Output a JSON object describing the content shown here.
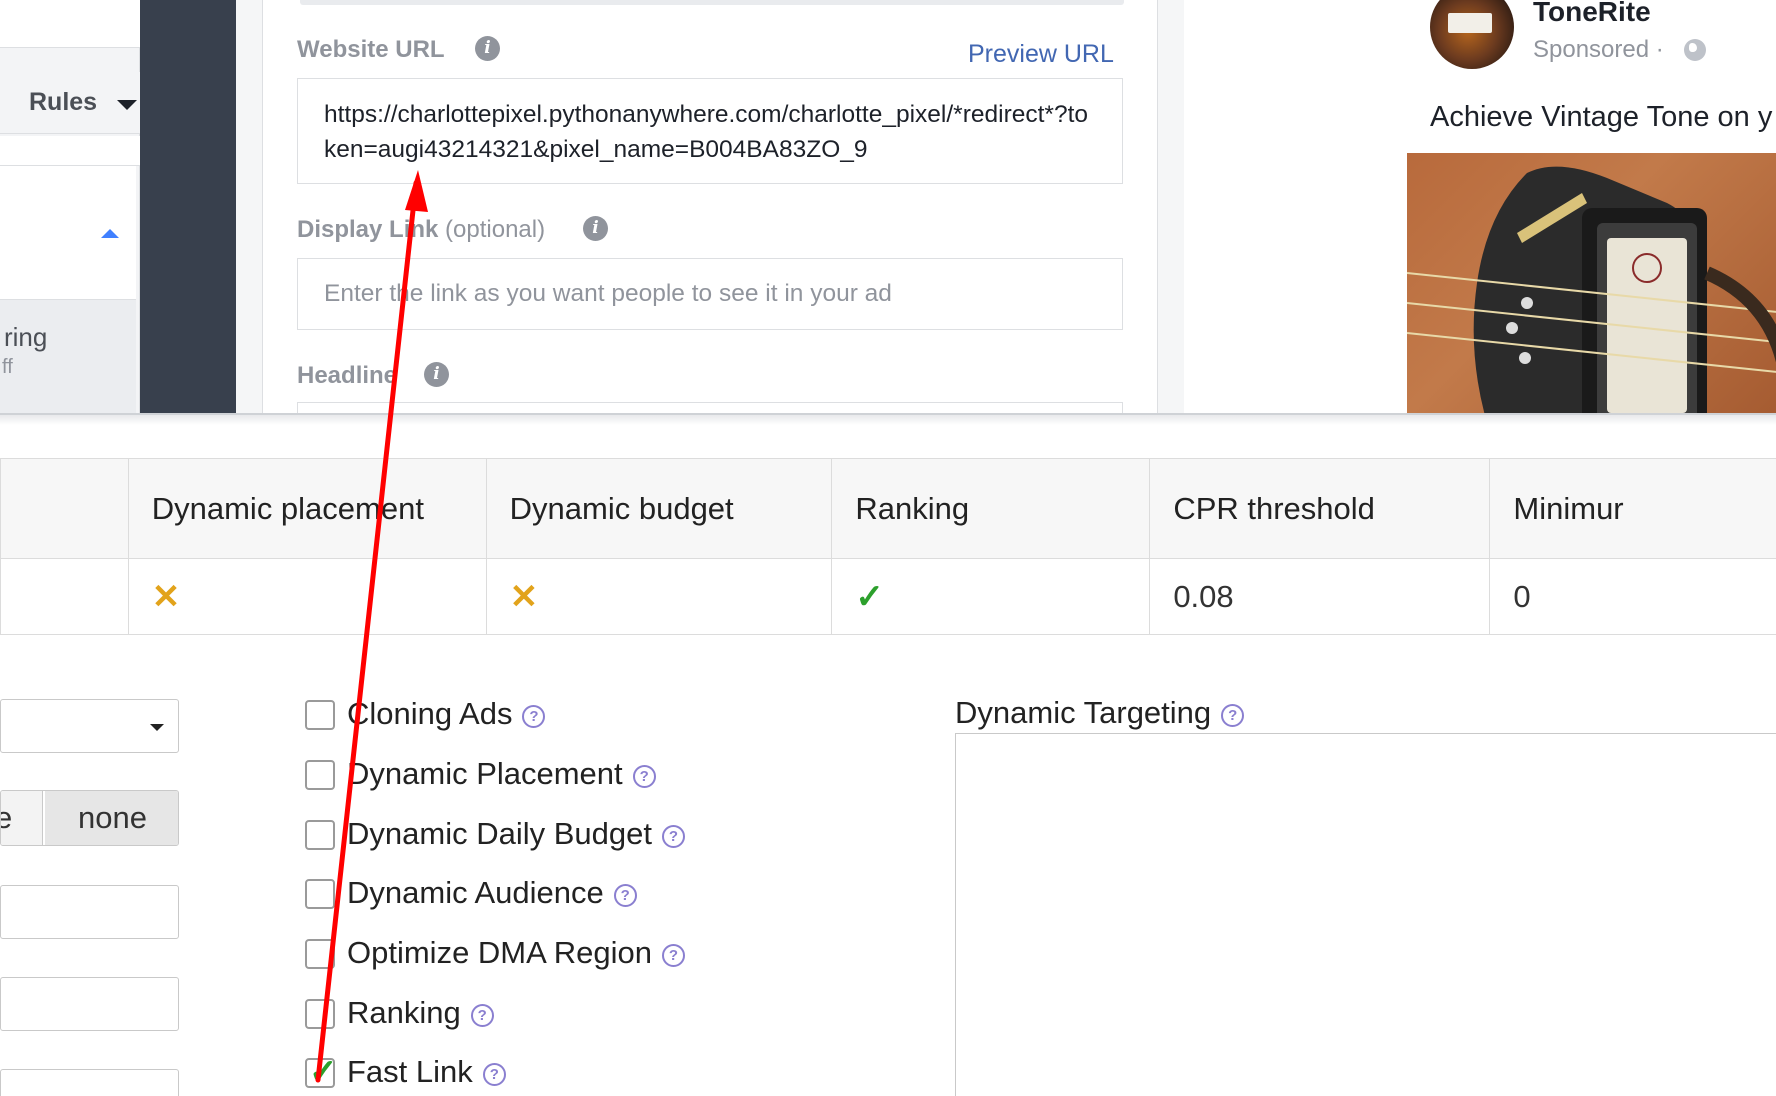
{
  "fb_editor": {
    "rules_label": "Rules",
    "sidebar_partial_text_1": "ring",
    "sidebar_partial_text_2": "ff",
    "website_url_label": "Website URL",
    "preview_url_link": "Preview URL",
    "website_url_value": "https://charlottepixel.pythonanywhere.com/charlotte_pixel/*redirect*?token=augi43214321&pixel_name=B004BA83ZO_9",
    "display_link_label": "Display Link",
    "display_link_optional": "(optional)",
    "display_link_placeholder": "Enter the link as you want people to see it in your ad",
    "headline_label": "Headline",
    "info_glyph": "i"
  },
  "ad_preview": {
    "page_name": "ToneRite",
    "sponsored_label": "Sponsored ·",
    "ad_text": "Achieve Vintage Tone on y"
  },
  "options_table": {
    "headers": [
      "",
      "Dynamic placement",
      "Dynamic budget",
      "Ranking",
      "CPR threshold",
      "Minimur"
    ],
    "row": {
      "dynamic_placement": "✕",
      "dynamic_budget": "✕",
      "ranking": "✓",
      "cpr_threshold": "0.08",
      "minimum": "0"
    }
  },
  "settings": {
    "segment_partial": "e",
    "segment_none": "none",
    "help_glyph": "?",
    "checkboxes": [
      {
        "label": "Cloning Ads",
        "checked": false
      },
      {
        "label": "Dynamic Placement",
        "checked": false
      },
      {
        "label": "Dynamic Daily Budget",
        "checked": false
      },
      {
        "label": "Dynamic Audience",
        "checked": false
      },
      {
        "label": "Optimize DMA Region",
        "checked": false
      },
      {
        "label": "Ranking",
        "checked": false
      },
      {
        "label": "Fast Link",
        "checked": true
      }
    ],
    "check_glyph": "✓",
    "dynamic_targeting_label": "Dynamic Targeting"
  },
  "colors": {
    "facebook_link_blue": "#4267b2",
    "annotation_arrow": "#ff0000",
    "false_mark": "#e2a31b",
    "true_mark": "#2ca02c"
  }
}
